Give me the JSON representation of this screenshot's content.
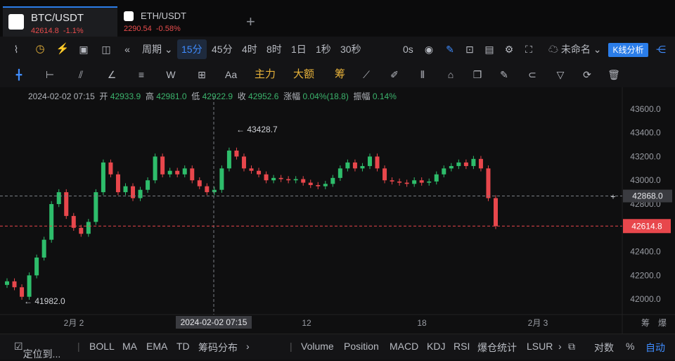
{
  "tabs": [
    {
      "symbol": "BTC/USDT",
      "price": "42614.8",
      "change": "-1.1%"
    },
    {
      "symbol": "ETH/USDT",
      "price": "2290.54",
      "change": "-0.58%"
    }
  ],
  "toolbar": {
    "period_label": "周期",
    "intervals": [
      "15分",
      "45分",
      "4时",
      "8时",
      "1日",
      "1秒",
      "30秒"
    ],
    "selected_interval": "15分",
    "timer": "0s",
    "layout_name": "未命名",
    "kline_analysis": "K线分析"
  },
  "draw_tools": {
    "font": "Aa",
    "main": "主力",
    "big": "大额",
    "chip": "筹"
  },
  "ohlc": {
    "datetime": "2024-02-02 07:15",
    "open_label": "开",
    "open": "42933.9",
    "high_label": "高",
    "high": "42981.0",
    "low_label": "低",
    "low": "42922.9",
    "close_label": "收",
    "close": "42952.6",
    "change_label": "涨幅",
    "change": "0.04%(18.8)",
    "amplitude_label": "振幅",
    "amplitude": "0.14%"
  },
  "chart_data": {
    "type": "candlestick",
    "y_ticks": [
      "43600.0",
      "43400.0",
      "43200.0",
      "43000.0",
      "42800.0",
      "42400.0",
      "42200.0",
      "42000.0"
    ],
    "x_ticks": [
      "2月 2",
      "12",
      "18",
      "2月 3"
    ],
    "crosshair_time": "2024-02-02 07:15",
    "crosshair_price": "42868.0",
    "last_price": "42614.8",
    "max_label": "43428.7",
    "min_label": "41982.0",
    "ylim": [
      41900,
      43700
    ],
    "closes": [
      42150,
      42100,
      42020,
      42200,
      42350,
      42500,
      42800,
      42900,
      42700,
      42600,
      42550,
      42650,
      42900,
      43150,
      43050,
      42900,
      42950,
      42850,
      42920,
      43000,
      43200,
      43050,
      43080,
      43050,
      43100,
      43000,
      42950,
      42900,
      42920,
      43100,
      43250,
      43200,
      43100,
      43080,
      43050,
      43000,
      43020,
      43010,
      43000,
      43010,
      42980,
      42960,
      42950,
      42970,
      43020,
      43100,
      43150,
      43100,
      43120,
      43200,
      43100,
      43000,
      42990,
      42980,
      42970,
      43000,
      42980,
      42990,
      43050,
      43100,
      43120,
      43150,
      43120,
      43180,
      43100,
      42850,
      42614.8
    ]
  },
  "bottom": {
    "locate": "定位到...",
    "indicators": [
      "BOLL",
      "MA",
      "EMA",
      "TD",
      "筹码分布"
    ],
    "sub": [
      "Volume",
      "Position",
      "MACD",
      "KDJ",
      "RSI",
      "爆仓统计",
      "LSUR"
    ],
    "log": "对数",
    "pct": "%",
    "auto": "自动"
  },
  "right_labels": {
    "chip": "筹",
    "burst": "爆"
  }
}
